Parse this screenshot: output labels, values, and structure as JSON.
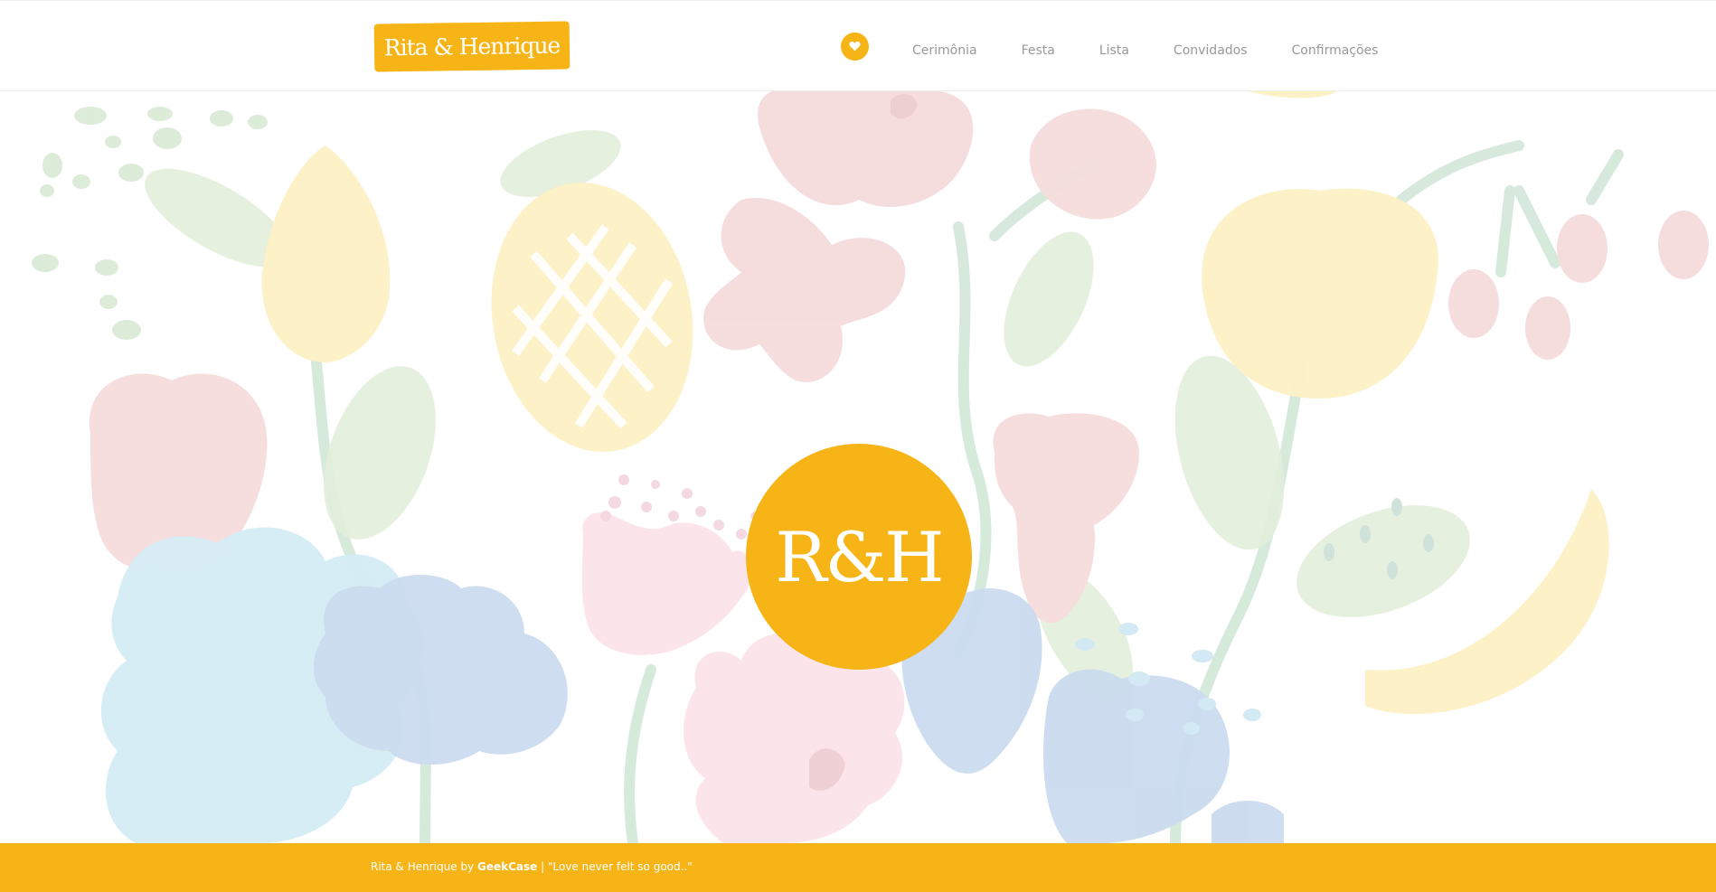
{
  "header": {
    "logo_text": "Rita & Henrique",
    "home_icon": "heart-icon",
    "nav": [
      {
        "label": "Cerimônia"
      },
      {
        "label": "Festa"
      },
      {
        "label": "Lista"
      },
      {
        "label": "Convidados"
      },
      {
        "label": "Confirmações"
      }
    ]
  },
  "hero": {
    "monogram": "R&H",
    "background": "pastel-floral-fruit-illustration"
  },
  "footer": {
    "site_name": "Rita & Henrique",
    "by": "by",
    "author": "GeekCase",
    "separator": "|",
    "tagline": "\"Love never felt so good..\""
  },
  "colors": {
    "accent": "#f7b417",
    "nav_text": "#999999",
    "white": "#ffffff"
  }
}
